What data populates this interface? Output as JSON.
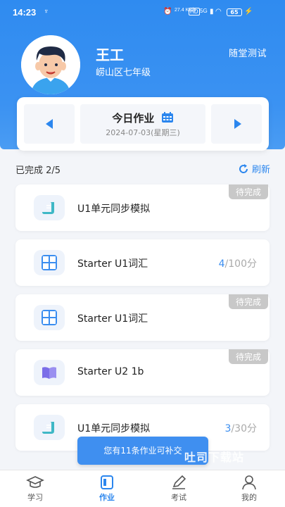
{
  "status_bar": {
    "time": "14:23",
    "network_speed": "27.4 KB/s",
    "hd": "HD",
    "signal": "5G",
    "battery": "65"
  },
  "profile": {
    "name": "王工",
    "class": "崂山区七年级",
    "quiz_link": "随堂测试"
  },
  "date_picker": {
    "title": "今日作业",
    "date": "2024-07-03(星期三)"
  },
  "progress": {
    "label": "已完成 2/5",
    "refresh_label": "刷新"
  },
  "homework_items": [
    {
      "title": "U1单元同步模拟",
      "icon": "scroll-icon",
      "badge": "待完成",
      "score": null,
      "total": null
    },
    {
      "title": "Starter U1词汇",
      "icon": "abcd-icon",
      "badge": null,
      "score": "4",
      "total": "/100分"
    },
    {
      "title": "Starter U1词汇",
      "icon": "abcd-icon",
      "badge": "待完成",
      "score": null,
      "total": null
    },
    {
      "title": "Starter U2 1b",
      "icon": "book-icon",
      "badge": "待完成",
      "score": null,
      "total": null
    },
    {
      "title": "U1单元同步模拟",
      "icon": "scroll-icon",
      "badge": null,
      "score": "3",
      "total": "/30分"
    }
  ],
  "toast": "您有11条作业可补交",
  "watermark": "吐司下载站",
  "tabs": [
    {
      "label": "学习",
      "icon": "graduation-cap-icon",
      "active": false
    },
    {
      "label": "作业",
      "icon": "homework-icon",
      "active": true
    },
    {
      "label": "考试",
      "icon": "pencil-icon",
      "active": false
    },
    {
      "label": "我的",
      "icon": "user-icon",
      "active": false
    }
  ],
  "colors": {
    "primary": "#2b86ee",
    "badge_gray": "#c8c8c8",
    "background": "#f3f5f9"
  }
}
